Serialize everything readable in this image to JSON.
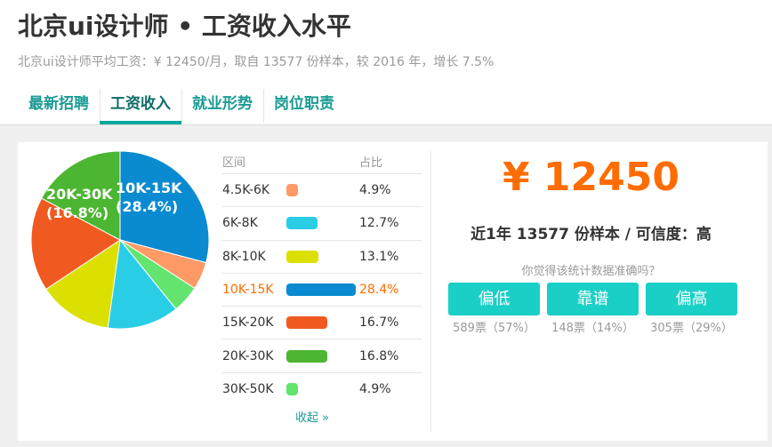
{
  "header": {
    "title": "北京ui设计师 • 工资收入水平",
    "subtitle": "北京ui设计师平均工资：¥ 12450/月，取自 13577 份样本，较 2016 年，增长 7.5%"
  },
  "tabs": [
    {
      "label": "最新招聘",
      "active": false
    },
    {
      "label": "工资收入",
      "active": true
    },
    {
      "label": "就业形势",
      "active": false
    },
    {
      "label": "岗位职责",
      "active": false
    }
  ],
  "distribution": {
    "col_range": "区间",
    "col_ratio": "占比",
    "rows": [
      {
        "range": "4.5K-6K",
        "pct": "4.9%",
        "value": 4.9,
        "color": "#ff9966"
      },
      {
        "range": "6K-8K",
        "pct": "12.7%",
        "value": 12.7,
        "color": "#29cde6"
      },
      {
        "range": "8K-10K",
        "pct": "13.1%",
        "value": 13.1,
        "color": "#dbe000"
      },
      {
        "range": "10K-15K",
        "pct": "28.4%",
        "value": 28.4,
        "color": "#0a8bd1",
        "highlight": true
      },
      {
        "range": "15K-20K",
        "pct": "16.7%",
        "value": 16.7,
        "color": "#f05a20"
      },
      {
        "range": "20K-30K",
        "pct": "16.8%",
        "value": 16.8,
        "color": "#4cb632"
      },
      {
        "range": "30K-50K",
        "pct": "4.9%",
        "value": 4.9,
        "color": "#62e46e"
      }
    ],
    "collapse_label": "收起 »"
  },
  "pie_labels": [
    {
      "range": "10K-15K",
      "pct": "(28.4%)"
    },
    {
      "range": "20K-30K",
      "pct": "(16.8%)"
    }
  ],
  "summary": {
    "salary": "¥ 12450",
    "sample_text": "近1年 13577 份样本 / 可信度：高",
    "question": "你觉得该统计数据准确吗？",
    "votes": [
      {
        "label": "偏低",
        "count": "589票（57%）"
      },
      {
        "label": "靠谱",
        "count": "148票（14%）"
      },
      {
        "label": "偏高",
        "count": "305票（29%）"
      }
    ]
  }
}
